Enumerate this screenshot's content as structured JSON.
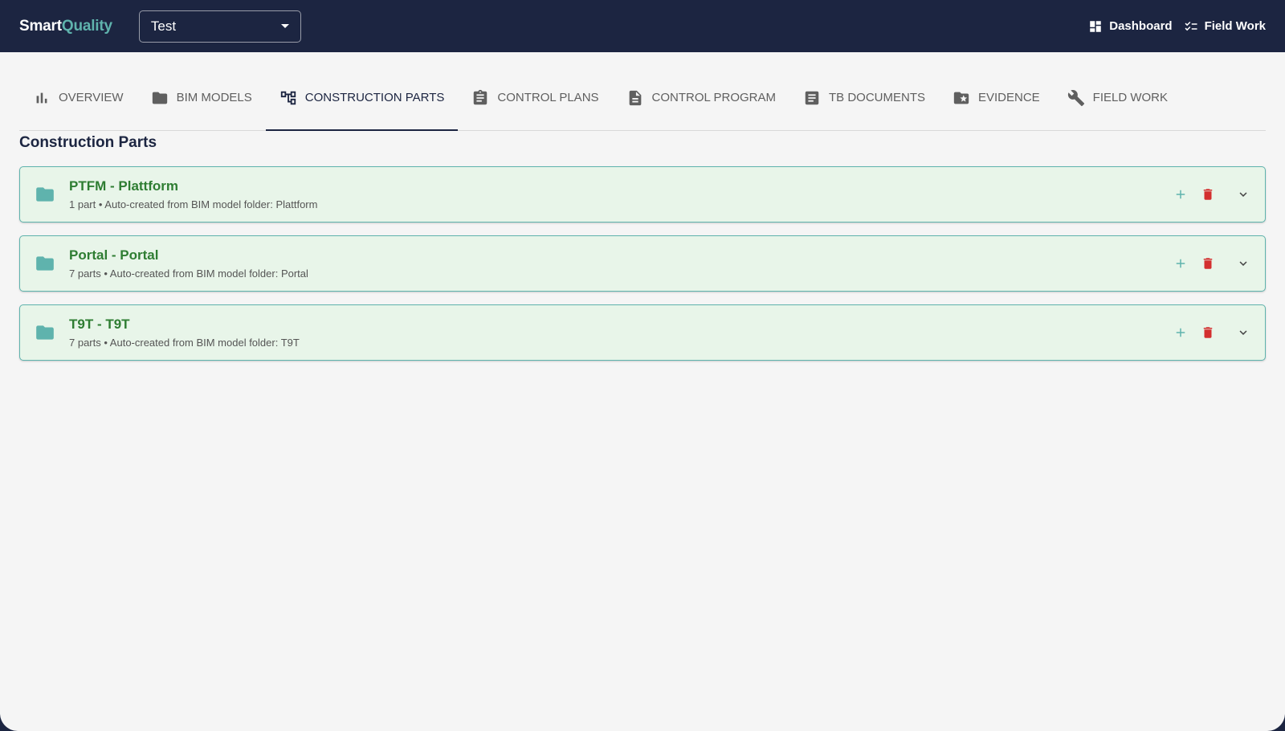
{
  "brand": {
    "part1": "Smart",
    "part2": "Quality"
  },
  "project_select": {
    "value": "Test"
  },
  "top_links": [
    {
      "label": "Dashboard",
      "icon": "dashboard-icon"
    },
    {
      "label": "Field Work",
      "icon": "checklist-icon"
    }
  ],
  "tabs": [
    {
      "label": "OVERVIEW",
      "icon": "bar-chart-icon",
      "active": false
    },
    {
      "label": "BIM MODELS",
      "icon": "folder-icon",
      "active": false
    },
    {
      "label": "CONSTRUCTION PARTS",
      "icon": "hierarchy-icon",
      "active": true
    },
    {
      "label": "CONTROL PLANS",
      "icon": "clipboard-icon",
      "active": false
    },
    {
      "label": "CONTROL PROGRAM",
      "icon": "document-icon",
      "active": false
    },
    {
      "label": "TB DOCUMENTS",
      "icon": "article-icon",
      "active": false
    },
    {
      "label": "EVIDENCE",
      "icon": "folder-star-icon",
      "active": false
    },
    {
      "label": "FIELD WORK",
      "icon": "wrench-icon",
      "active": false
    }
  ],
  "section_title": "Construction Parts",
  "parts": [
    {
      "title": "PTFM - Plattform",
      "subtitle": "1 part • Auto-created from BIM model folder: Plattform"
    },
    {
      "title": "Portal - Portal",
      "subtitle": "7 parts • Auto-created from BIM model folder: Portal"
    },
    {
      "title": "T9T - T9T",
      "subtitle": "7 parts • Auto-created from BIM model folder: T9T"
    }
  ],
  "colors": {
    "navy": "#1c2541",
    "teal": "#5fb3ad",
    "card_bg": "#e8f5e9",
    "title_green": "#2e7d32",
    "delete_red": "#d32f2f"
  }
}
